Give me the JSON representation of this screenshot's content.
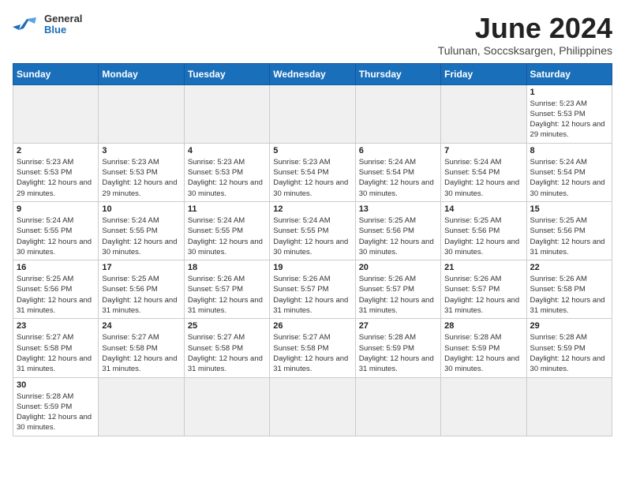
{
  "header": {
    "logo_general": "General",
    "logo_blue": "Blue",
    "title": "June 2024",
    "subtitle": "Tulunan, Soccsksargen, Philippines"
  },
  "weekdays": [
    "Sunday",
    "Monday",
    "Tuesday",
    "Wednesday",
    "Thursday",
    "Friday",
    "Saturday"
  ],
  "weeks": [
    [
      {
        "day": null,
        "empty": true
      },
      {
        "day": null,
        "empty": true
      },
      {
        "day": null,
        "empty": true
      },
      {
        "day": null,
        "empty": true
      },
      {
        "day": null,
        "empty": true
      },
      {
        "day": null,
        "empty": true
      },
      {
        "day": 1,
        "sunrise": "5:23 AM",
        "sunset": "5:53 PM",
        "daylight": "12 hours and 29 minutes."
      }
    ],
    [
      {
        "day": 2,
        "sunrise": "5:23 AM",
        "sunset": "5:53 PM",
        "daylight": "12 hours and 29 minutes."
      },
      {
        "day": 3,
        "sunrise": "5:23 AM",
        "sunset": "5:53 PM",
        "daylight": "12 hours and 29 minutes."
      },
      {
        "day": 4,
        "sunrise": "5:23 AM",
        "sunset": "5:53 PM",
        "daylight": "12 hours and 30 minutes."
      },
      {
        "day": 5,
        "sunrise": "5:23 AM",
        "sunset": "5:54 PM",
        "daylight": "12 hours and 30 minutes."
      },
      {
        "day": 6,
        "sunrise": "5:24 AM",
        "sunset": "5:54 PM",
        "daylight": "12 hours and 30 minutes."
      },
      {
        "day": 7,
        "sunrise": "5:24 AM",
        "sunset": "5:54 PM",
        "daylight": "12 hours and 30 minutes."
      },
      {
        "day": 8,
        "sunrise": "5:24 AM",
        "sunset": "5:54 PM",
        "daylight": "12 hours and 30 minutes."
      }
    ],
    [
      {
        "day": 9,
        "sunrise": "5:24 AM",
        "sunset": "5:55 PM",
        "daylight": "12 hours and 30 minutes."
      },
      {
        "day": 10,
        "sunrise": "5:24 AM",
        "sunset": "5:55 PM",
        "daylight": "12 hours and 30 minutes."
      },
      {
        "day": 11,
        "sunrise": "5:24 AM",
        "sunset": "5:55 PM",
        "daylight": "12 hours and 30 minutes."
      },
      {
        "day": 12,
        "sunrise": "5:24 AM",
        "sunset": "5:55 PM",
        "daylight": "12 hours and 30 minutes."
      },
      {
        "day": 13,
        "sunrise": "5:25 AM",
        "sunset": "5:56 PM",
        "daylight": "12 hours and 30 minutes."
      },
      {
        "day": 14,
        "sunrise": "5:25 AM",
        "sunset": "5:56 PM",
        "daylight": "12 hours and 30 minutes."
      },
      {
        "day": 15,
        "sunrise": "5:25 AM",
        "sunset": "5:56 PM",
        "daylight": "12 hours and 31 minutes."
      }
    ],
    [
      {
        "day": 16,
        "sunrise": "5:25 AM",
        "sunset": "5:56 PM",
        "daylight": "12 hours and 31 minutes."
      },
      {
        "day": 17,
        "sunrise": "5:25 AM",
        "sunset": "5:56 PM",
        "daylight": "12 hours and 31 minutes."
      },
      {
        "day": 18,
        "sunrise": "5:26 AM",
        "sunset": "5:57 PM",
        "daylight": "12 hours and 31 minutes."
      },
      {
        "day": 19,
        "sunrise": "5:26 AM",
        "sunset": "5:57 PM",
        "daylight": "12 hours and 31 minutes."
      },
      {
        "day": 20,
        "sunrise": "5:26 AM",
        "sunset": "5:57 PM",
        "daylight": "12 hours and 31 minutes."
      },
      {
        "day": 21,
        "sunrise": "5:26 AM",
        "sunset": "5:57 PM",
        "daylight": "12 hours and 31 minutes."
      },
      {
        "day": 22,
        "sunrise": "5:26 AM",
        "sunset": "5:58 PM",
        "daylight": "12 hours and 31 minutes."
      }
    ],
    [
      {
        "day": 23,
        "sunrise": "5:27 AM",
        "sunset": "5:58 PM",
        "daylight": "12 hours and 31 minutes."
      },
      {
        "day": 24,
        "sunrise": "5:27 AM",
        "sunset": "5:58 PM",
        "daylight": "12 hours and 31 minutes."
      },
      {
        "day": 25,
        "sunrise": "5:27 AM",
        "sunset": "5:58 PM",
        "daylight": "12 hours and 31 minutes."
      },
      {
        "day": 26,
        "sunrise": "5:27 AM",
        "sunset": "5:58 PM",
        "daylight": "12 hours and 31 minutes."
      },
      {
        "day": 27,
        "sunrise": "5:28 AM",
        "sunset": "5:59 PM",
        "daylight": "12 hours and 31 minutes."
      },
      {
        "day": 28,
        "sunrise": "5:28 AM",
        "sunset": "5:59 PM",
        "daylight": "12 hours and 30 minutes."
      },
      {
        "day": 29,
        "sunrise": "5:28 AM",
        "sunset": "5:59 PM",
        "daylight": "12 hours and 30 minutes."
      }
    ],
    [
      {
        "day": 30,
        "sunrise": "5:28 AM",
        "sunset": "5:59 PM",
        "daylight": "12 hours and 30 minutes."
      },
      {
        "day": null,
        "empty": true
      },
      {
        "day": null,
        "empty": true
      },
      {
        "day": null,
        "empty": true
      },
      {
        "day": null,
        "empty": true
      },
      {
        "day": null,
        "empty": true
      },
      {
        "day": null,
        "empty": true
      }
    ]
  ]
}
